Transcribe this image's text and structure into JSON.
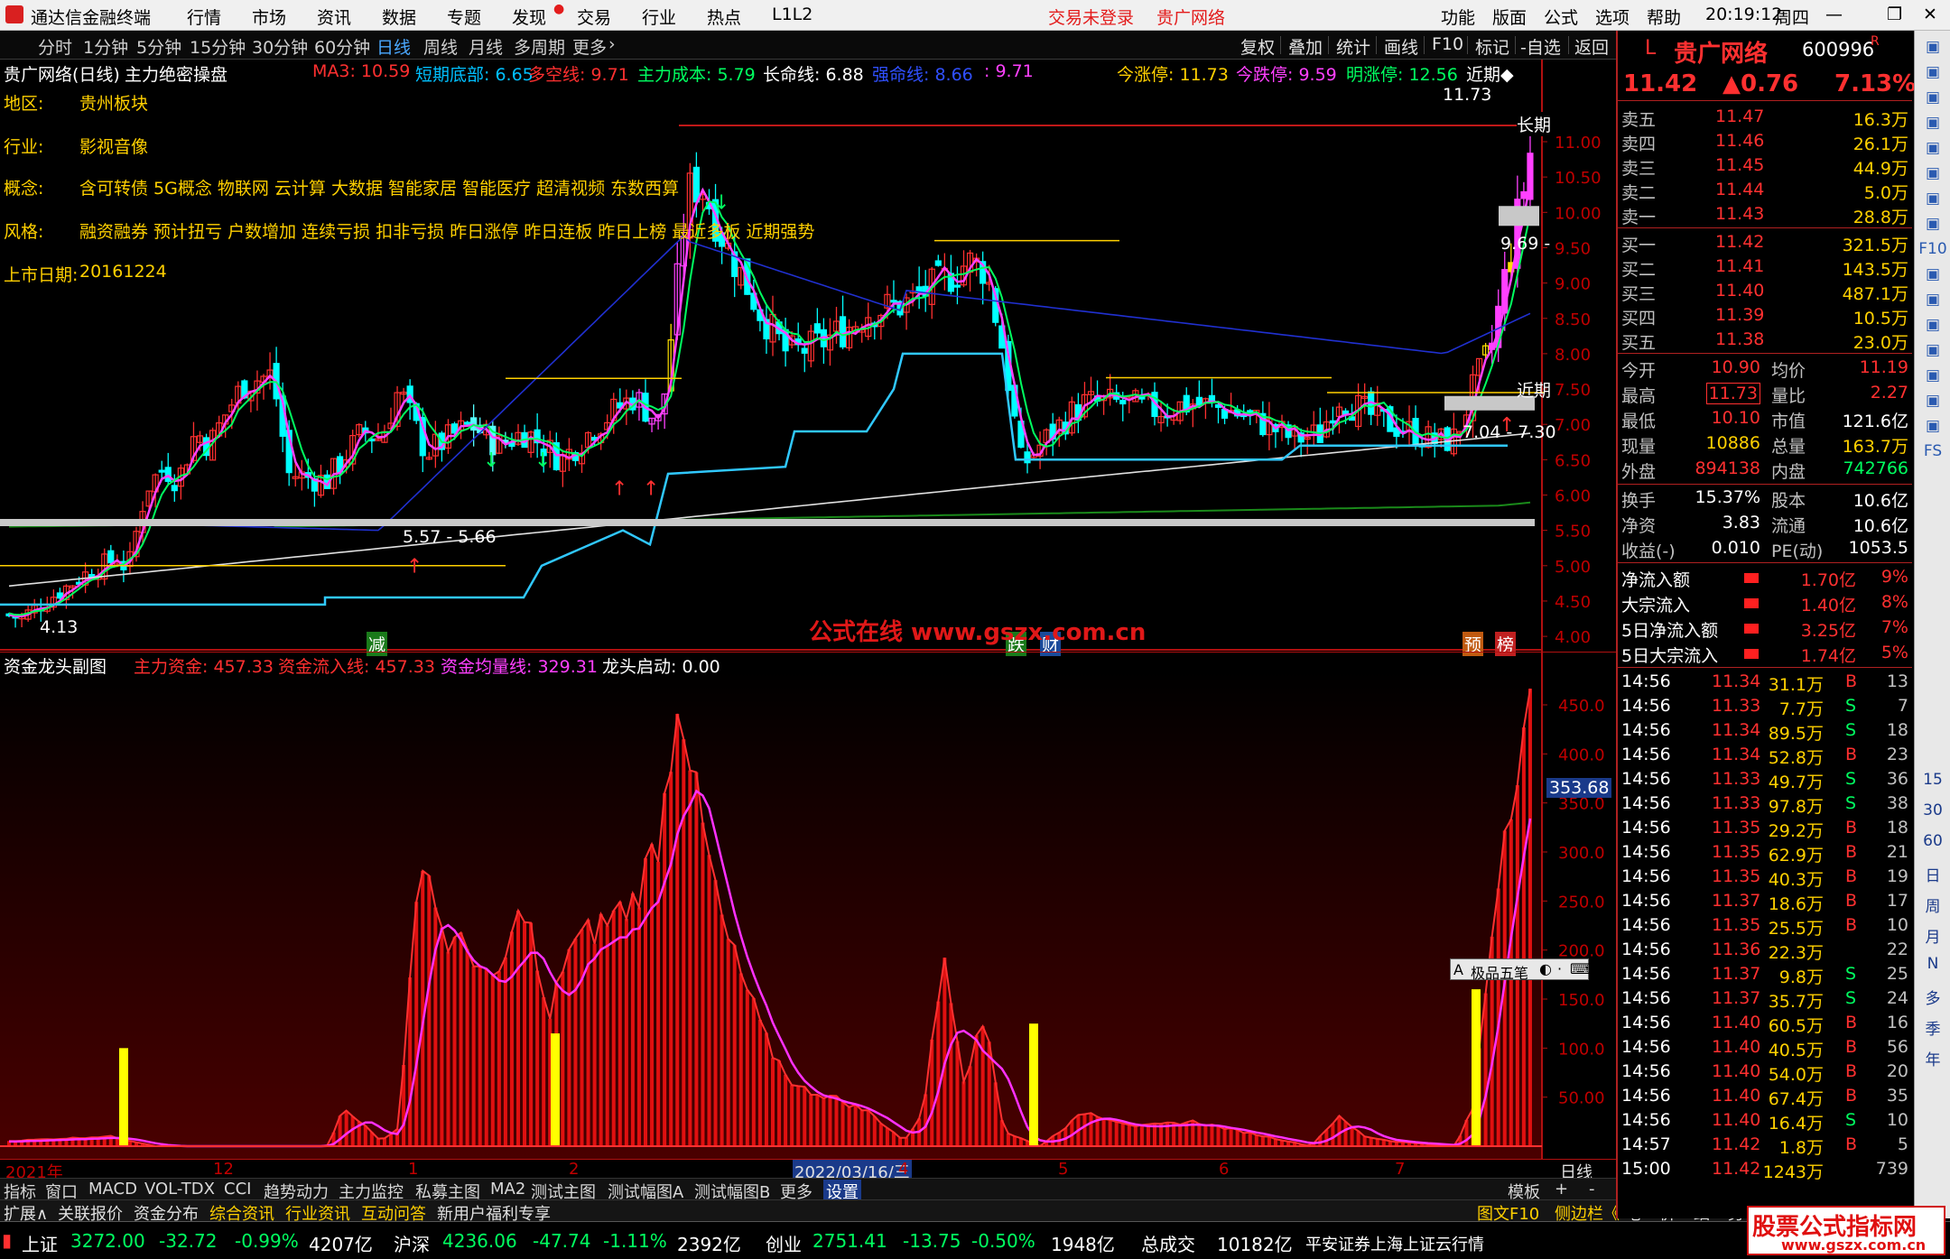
{
  "titlebar": {
    "app": "通达信金融终端",
    "menus": [
      "行情",
      "市场",
      "资讯",
      "数据",
      "专题",
      "发现",
      "交易",
      "行业",
      "热点",
      "L1L2"
    ],
    "login": "交易未登录",
    "stock_title": "贵广网络",
    "right_menus": [
      "功能",
      "版面",
      "公式",
      "选项",
      "帮助"
    ],
    "time": "20:19:12",
    "weekday": "周四"
  },
  "periods": {
    "items": [
      "分时",
      "1分钟",
      "5分钟",
      "15分钟",
      "30分钟",
      "60分钟",
      "日线",
      "周线",
      "月线",
      "多周期",
      "更多"
    ],
    "active": "日线",
    "tools": [
      "复权",
      "叠加",
      "统计",
      "画线",
      "F10",
      "标记",
      "-自选",
      "返回"
    ]
  },
  "main": {
    "title": "贵广网络(日线)",
    "formula": "主力绝密操盘",
    "indicators": [
      {
        "label": "MA3: 10.59",
        "color": "#ff3030"
      },
      {
        "label": "短期底部: 6.65",
        "color": "#00c0ff"
      },
      {
        "label": "多空线: 9.71",
        "color": "#ff3030"
      },
      {
        "label": "主力成本: 5.79",
        "color": "#00ff60"
      },
      {
        "label": "长命线: 6.88",
        "color": "#ffffff"
      },
      {
        "label": "强命线: 8.66",
        "color": "#3050ff"
      },
      {
        "label": ": 9.71",
        "color": "#ff40ff"
      }
    ],
    "limits": [
      {
        "label": "今涨停: 11.73",
        "color": "#ffd000"
      },
      {
        "label": "今跌停: 9.59",
        "color": "#ff40ff"
      },
      {
        "label": "明涨停: 12.56",
        "color": "#00ff60"
      },
      {
        "label": "近期◆",
        "color": "#ffffff"
      }
    ],
    "info": {
      "region_label": "地区:",
      "region": "贵州板块",
      "industry_label": "行业:",
      "industry": "影视音像",
      "concept_label": "概念:",
      "concept": "含可转债 5G概念 物联网 云计算 大数据 智能家居 智能医疗 超清视频 东数西算",
      "style_label": "风格:",
      "style": "融资融券 预计扭亏 户数增加 连续亏损 扣非亏损 昨日涨停 昨日连板 昨日上榜 最近多板 近期强势",
      "listing_label": "上市日期:",
      "listing": "20161224"
    },
    "price_axis": [
      "11.00",
      "10.50",
      "10.00",
      "9.50",
      "9.00",
      "8.50",
      "8.00",
      "7.50",
      "7.00",
      "6.50",
      "6.00",
      "5.50",
      "5.00",
      "4.50",
      "4.00"
    ],
    "annotations": {
      "high": "11.73",
      "long_label": "长期",
      "near_label": "近期",
      "pivot": "9.69 -",
      "range1": "7.04 - 7.30",
      "range2": "5.57 - 5.66",
      "low": "4.13",
      "markers": [
        "减",
        "跌",
        "财",
        "预",
        "榜"
      ]
    },
    "watermark_text": "公式在线  www.gszx.com.cn"
  },
  "sub": {
    "title": "资金龙头副图",
    "indicators": [
      {
        "label": "主力资金: 457.33",
        "color": "#ff3030"
      },
      {
        "label": "资金流入线: 457.33",
        "color": "#ff3030"
      },
      {
        "label": "资金均量线: 329.31",
        "color": "#ff40ff"
      },
      {
        "label": "龙头启动: 0.00",
        "color": "#ffffff"
      }
    ],
    "axis": [
      "450.0",
      "400.0",
      "350.0",
      "300.0",
      "250.0",
      "200.0",
      "150.0",
      "100.0",
      "50.00"
    ],
    "axis_tag": "353.68",
    "ime": "极品五笔"
  },
  "dates": {
    "items": [
      "2021年",
      "12",
      "1",
      "2",
      "2022/03/16/三",
      "4",
      "5",
      "6",
      "7"
    ],
    "period": "日线"
  },
  "bottom_tabs": [
    "指标",
    "窗口",
    "MACD",
    "VOL-TDX",
    "CCI",
    "趋势动力",
    "主力监控",
    "私募主图",
    "MA2",
    "测试主图",
    "测试幅图A",
    "测试幅图B",
    "更多",
    "设置"
  ],
  "bottom_tabs_right": [
    "模板",
    "+",
    "-"
  ],
  "bottom_tabs2": [
    "扩展∧",
    "关联报价",
    "资金分布",
    "综合资讯",
    "行业资讯",
    "互动问答",
    "新用户福利专享"
  ],
  "bottom_tabs2_right": [
    "图文F10",
    "侧边栏《",
    "笔",
    "价",
    "细",
    "势"
  ],
  "quote": {
    "name": "贵广网络",
    "code": "600996",
    "tag": "R",
    "prefix": "L",
    "price": "11.42",
    "change": "▲0.76",
    "pct": "7.13%",
    "asks": [
      {
        "label": "卖五",
        "p": "11.47",
        "v": "16.3万"
      },
      {
        "label": "卖四",
        "p": "11.46",
        "v": "26.1万"
      },
      {
        "label": "卖三",
        "p": "11.45",
        "v": "44.9万"
      },
      {
        "label": "卖二",
        "p": "11.44",
        "v": "5.0万"
      },
      {
        "label": "卖一",
        "p": "11.43",
        "v": "28.8万"
      }
    ],
    "bids": [
      {
        "label": "买一",
        "p": "11.42",
        "v": "321.5万"
      },
      {
        "label": "买二",
        "p": "11.41",
        "v": "143.5万"
      },
      {
        "label": "买三",
        "p": "11.40",
        "v": "487.1万"
      },
      {
        "label": "买四",
        "p": "11.39",
        "v": "10.5万"
      },
      {
        "label": "买五",
        "p": "11.38",
        "v": "23.0万"
      }
    ],
    "stats": [
      {
        "l1": "今开",
        "v1": "10.90",
        "c1": "#ff3030",
        "l2": "均价",
        "v2": "11.19",
        "c2": "#ff3030"
      },
      {
        "l1": "最高",
        "v1": "11.73",
        "c1": "#ff3030",
        "l2": "量比",
        "v2": "2.27",
        "c2": "#ff3030"
      },
      {
        "l1": "最低",
        "v1": "10.10",
        "c1": "#ff3030",
        "l2": "市值",
        "v2": "121.6亿",
        "c2": "#ffffff"
      },
      {
        "l1": "现量",
        "v1": "10886",
        "c1": "#ffd000",
        "l2": "总量",
        "v2": "163.7万",
        "c2": "#ffd000"
      },
      {
        "l1": "外盘",
        "v1": "894138",
        "c1": "#ff3030",
        "l2": "内盘",
        "v2": "742766",
        "c2": "#00ff60"
      },
      {
        "l1": "换手",
        "v1": "15.37%",
        "c1": "#ffffff",
        "l2": "股本",
        "v2": "10.6亿",
        "c2": "#ffffff"
      },
      {
        "l1": "净资",
        "v1": "3.83",
        "c1": "#ffffff",
        "l2": "流通",
        "v2": "10.6亿",
        "c2": "#ffffff"
      },
      {
        "l1": "收益(-)",
        "v1": "0.010",
        "c1": "#ffffff",
        "l2": "PE(动)",
        "v2": "1053.5",
        "c2": "#ffffff"
      }
    ],
    "flows": [
      {
        "label": "净流入额",
        "v": "1.70亿",
        "pct": "9%"
      },
      {
        "label": "大宗流入",
        "v": "1.40亿",
        "pct": "8%"
      },
      {
        "label": "5日净流入额",
        "v": "3.25亿",
        "pct": "7%"
      },
      {
        "label": "5日大宗流入",
        "v": "1.74亿",
        "pct": "5%"
      }
    ],
    "ticks": [
      [
        "14:56",
        "11.34",
        "31.1万",
        "B",
        "13"
      ],
      [
        "14:56",
        "11.33",
        "7.7万",
        "S",
        "7"
      ],
      [
        "14:56",
        "11.34",
        "89.5万",
        "S",
        "18"
      ],
      [
        "14:56",
        "11.34",
        "52.8万",
        "B",
        "23"
      ],
      [
        "14:56",
        "11.33",
        "49.7万",
        "S",
        "36"
      ],
      [
        "14:56",
        "11.33",
        "97.8万",
        "S",
        "38"
      ],
      [
        "14:56",
        "11.35",
        "29.2万",
        "B",
        "18"
      ],
      [
        "14:56",
        "11.35",
        "62.9万",
        "B",
        "21"
      ],
      [
        "14:56",
        "11.35",
        "40.3万",
        "B",
        "19"
      ],
      [
        "14:56",
        "11.37",
        "18.6万",
        "B",
        "17"
      ],
      [
        "14:56",
        "11.35",
        "25.5万",
        "B",
        "10"
      ],
      [
        "14:56",
        "11.36",
        "22.3万",
        "",
        "22"
      ],
      [
        "14:56",
        "11.37",
        "9.8万",
        "S",
        "25"
      ],
      [
        "14:56",
        "11.37",
        "35.7万",
        "S",
        "24"
      ],
      [
        "14:56",
        "11.40",
        "60.5万",
        "B",
        "16"
      ],
      [
        "14:56",
        "11.40",
        "40.5万",
        "B",
        "56"
      ],
      [
        "14:56",
        "11.40",
        "54.0万",
        "B",
        "20"
      ],
      [
        "14:56",
        "11.40",
        "67.4万",
        "B",
        "35"
      ],
      [
        "14:56",
        "11.40",
        "16.4万",
        "S",
        "10"
      ],
      [
        "14:57",
        "11.42",
        "1.8万",
        "B",
        "5"
      ],
      [
        "15:00",
        "11.42",
        "1243万",
        "",
        "739"
      ]
    ]
  },
  "sidebar": [
    "15",
    "30",
    "60",
    "日",
    "周",
    "月",
    "N",
    "多",
    "季",
    "年"
  ],
  "status": [
    {
      "name": "上证",
      "v": "3272.00",
      "c": "-32.72",
      "p": "-0.99%",
      "amt": "4207亿"
    },
    {
      "name": "沪深",
      "v": "4236.06",
      "c": "-47.74",
      "p": "-1.11%",
      "amt": "2392亿"
    },
    {
      "name": "创业",
      "v": "2751.41",
      "c": "-13.75",
      "p": "-0.50%",
      "amt": "1948亿"
    }
  ],
  "status_total_label": "总成交",
  "status_total": "10182亿",
  "status_broker": "平安证券上海上证云行情",
  "site_badge": {
    "line1": "股票公式指标网",
    "line2": "www.gszx.com.cn"
  },
  "colors": {
    "up": "#ff3030",
    "down": "#00ffff",
    "gold": "#ffd000",
    "magenta": "#ff40ff",
    "green": "#00ff60",
    "blue": "#3050ff",
    "axis": "#b01010"
  }
}
